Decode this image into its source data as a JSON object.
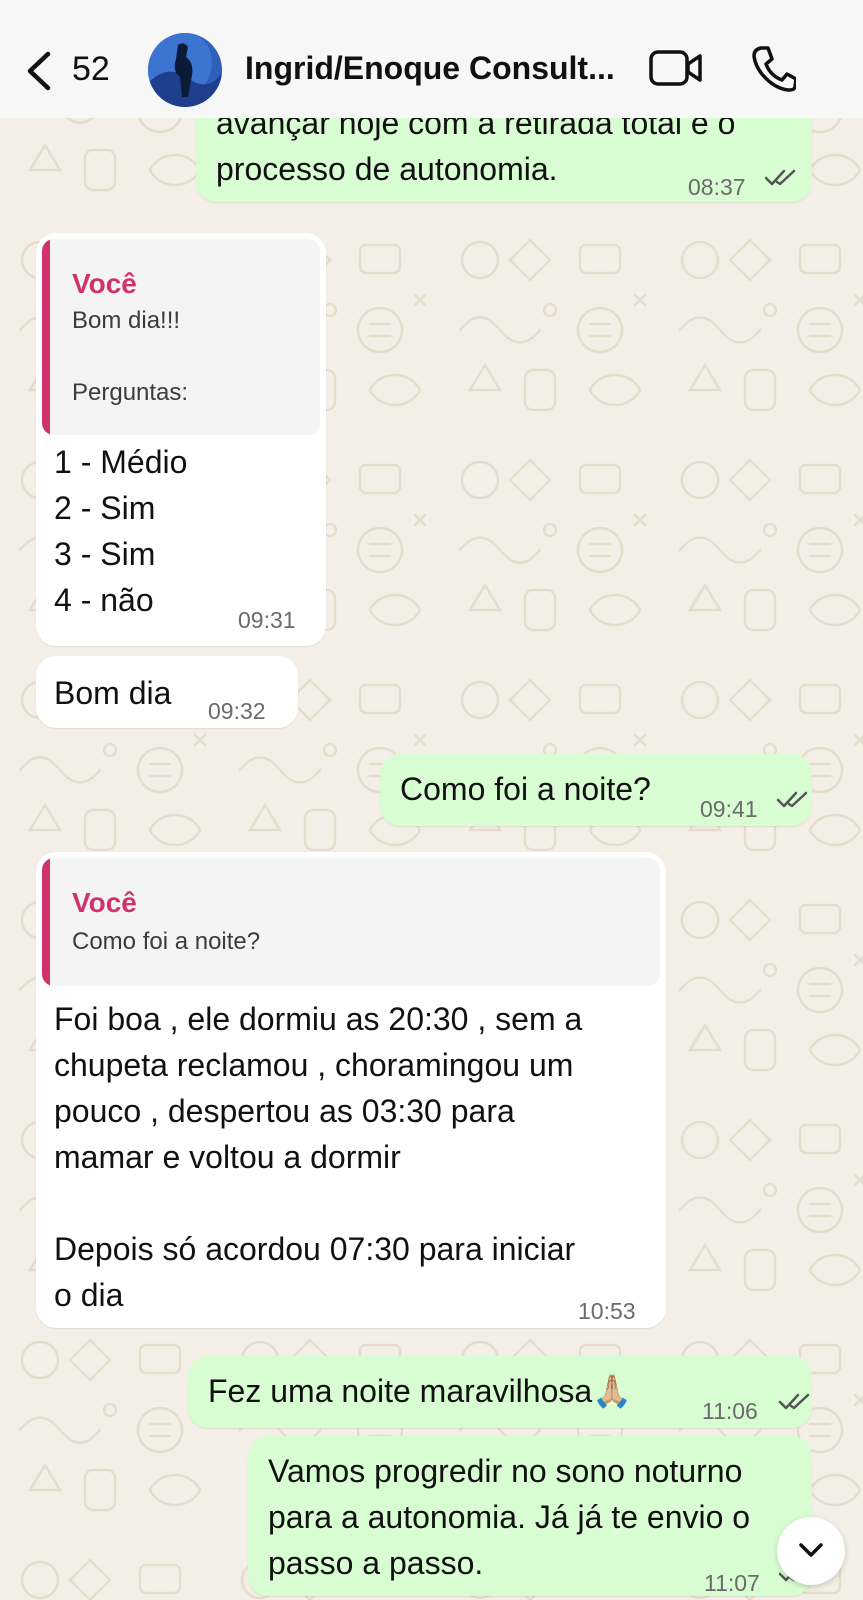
{
  "header": {
    "back_count": "52",
    "title": "Ingrid/Enoque Consult...",
    "icons": [
      "back-chevron-icon",
      "video-call-icon",
      "phone-call-icon"
    ]
  },
  "messages": [
    {
      "id": "m1",
      "direction": "outgoing",
      "text": "avançar hoje com a retirada total e o\nprocesso de autonomia.",
      "time": "08:37",
      "status": "read"
    },
    {
      "id": "m2",
      "direction": "incoming",
      "quote": {
        "author": "Você",
        "text": "Bom dia!!!\n\nPerguntas:"
      },
      "text": "1 - Médio\n2 - Sim\n3 - Sim\n4 - não",
      "time": "09:31"
    },
    {
      "id": "m3",
      "direction": "incoming",
      "text": "Bom dia",
      "time": "09:32"
    },
    {
      "id": "m4",
      "direction": "outgoing",
      "text": "Como foi a noite?",
      "time": "09:41",
      "status": "read"
    },
    {
      "id": "m5",
      "direction": "incoming",
      "quote": {
        "author": "Você",
        "text": "Como foi a noite?"
      },
      "text": "Foi boa , ele dormiu as 20:30 , sem a\nchupeta reclamou , choramingou um\npouco , despertou as 03:30 para\nmamar e voltou a dormir\n\nDepois só acordou 07:30 para iniciar\no dia",
      "time": "10:53"
    },
    {
      "id": "m6",
      "direction": "outgoing",
      "text": "Fez uma noite maravilhosa🙏🏼",
      "time": "11:06",
      "status": "read"
    },
    {
      "id": "m7",
      "direction": "outgoing",
      "text": "Vamos progredir no sono noturno\npara a autonomia. Já já te envio o\npasso a passo.",
      "time": "11:07",
      "status": "read"
    }
  ],
  "colors": {
    "outgoing_bubble": "#d9fdd3",
    "incoming_bubble": "#ffffff",
    "quote_accent": "#d0336b",
    "wallpaper": "#f4efe6"
  }
}
